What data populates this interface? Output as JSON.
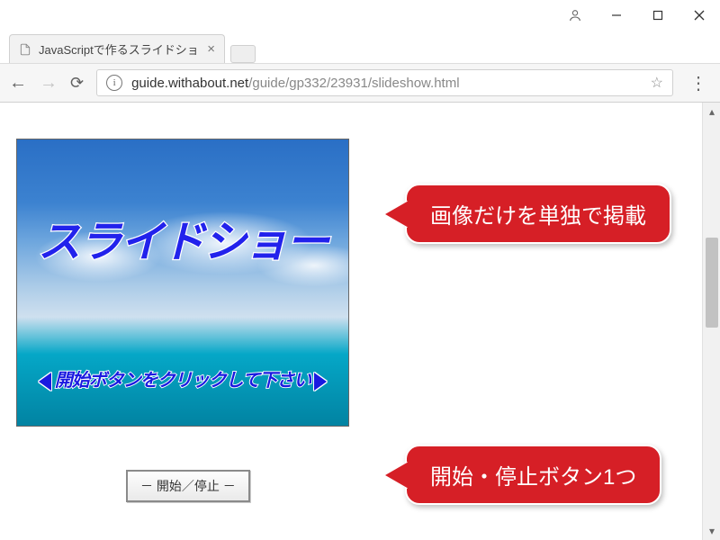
{
  "browser": {
    "tab_title": "JavaScriptで作るスライドショ",
    "url_host": "guide.withabout.net",
    "url_path": "/guide/gp332/23931/slideshow.html"
  },
  "slideshow": {
    "title": "スライドショー",
    "subtitle": "開始ボタンをクリックして下さい"
  },
  "controls": {
    "start_stop_label": "－ 開始／停止 －"
  },
  "callouts": {
    "image_only": "画像だけを単独で掲載",
    "one_button": "開始・停止ボタン1つ"
  },
  "colors": {
    "callout_bg": "#d61f26",
    "slide_text": "#2222ec"
  }
}
